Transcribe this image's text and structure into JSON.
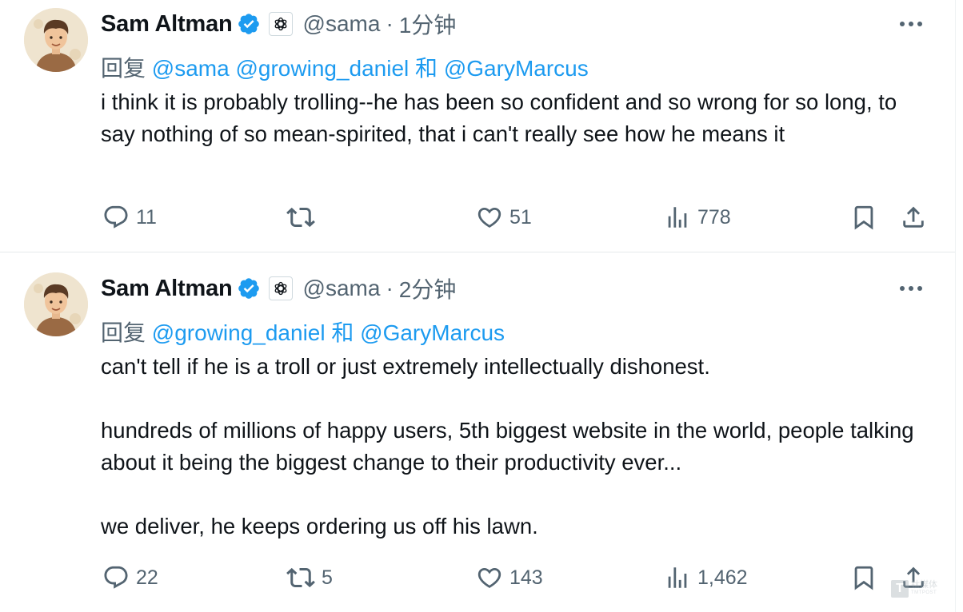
{
  "tweets": [
    {
      "author_name": "Sam Altman",
      "handle": "@sama",
      "separator": "·",
      "time": "1分钟",
      "reply_prefix": "回复",
      "mentions": [
        "@sama",
        "@growing_daniel",
        "和",
        "@GaryMarcus"
      ],
      "paragraphs": [
        "i think it is probably trolling--he has been so confident and so wrong for so long, to say nothing of so mean-spirited, that i can't really see how he means it"
      ],
      "actions": {
        "replies": "11",
        "reposts": "",
        "likes": "51",
        "views": "778"
      }
    },
    {
      "author_name": "Sam Altman",
      "handle": "@sama",
      "separator": "·",
      "time": "2分钟",
      "reply_prefix": "回复",
      "mentions": [
        "@growing_daniel",
        "和",
        "@GaryMarcus"
      ],
      "paragraphs": [
        "can't tell if he is a troll or just extremely intellectually dishonest.",
        "hundreds of millions of happy users, 5th biggest website in the world, people talking about it being the biggest change to their productivity ever...",
        "we deliver, he keeps ordering us off his lawn."
      ],
      "actions": {
        "replies": "22",
        "reposts": "5",
        "likes": "143",
        "views": "1,462"
      }
    }
  ],
  "watermark": {
    "mark": "T",
    "cn": "钛媒体",
    "en": "TMTPOST"
  },
  "icons": {
    "verified": "verified-badge-icon",
    "affiliate": "openai-logo-icon",
    "more": "more-horizontal-icon",
    "reply": "reply-icon",
    "repost": "repost-icon",
    "like": "heart-icon",
    "views": "views-icon",
    "bookmark": "bookmark-icon",
    "share": "share-icon"
  },
  "colors": {
    "text": "#0f1419",
    "secondary": "#536471",
    "link": "#1d9bf0",
    "verified": "#1d9bf0",
    "divider": "#e6e9eb"
  }
}
